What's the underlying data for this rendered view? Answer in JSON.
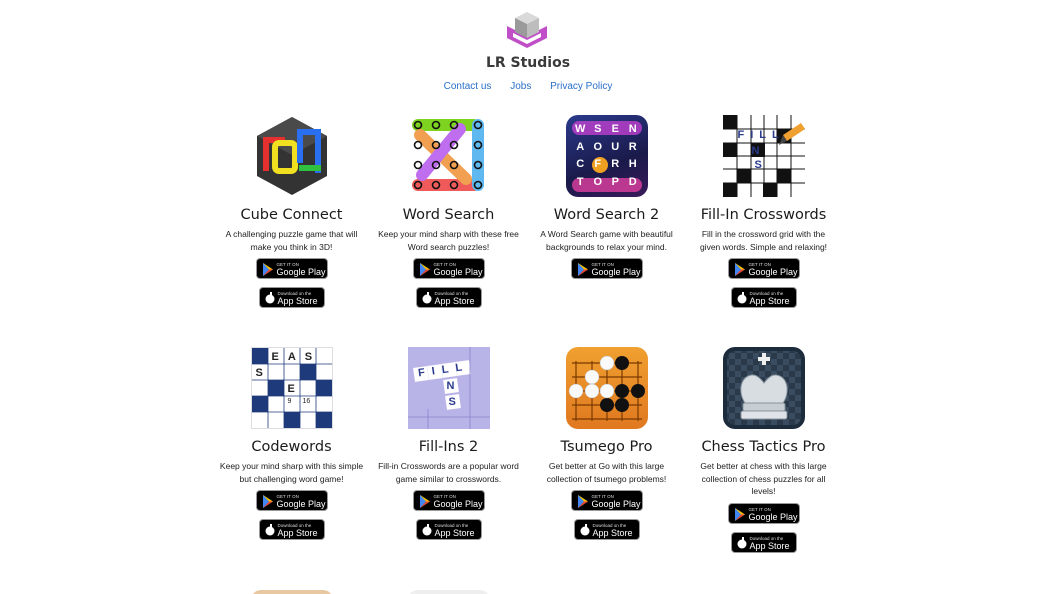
{
  "brand": {
    "name": "LR Studios",
    "logo_icon": "cube-logo-icon"
  },
  "nav": [
    {
      "label": "Contact us"
    },
    {
      "label": "Jobs"
    },
    {
      "label": "Privacy Policy"
    }
  ],
  "store_badges": {
    "google_small": "GET IT ON",
    "google_big": "Google Play",
    "apple_small": "Download on the",
    "apple_big": "App Store"
  },
  "apps": [
    {
      "title": "Cube Connect",
      "description": "A challenging puzzle game that will make you think in 3D!",
      "icon": "cube-connect-icon"
    },
    {
      "title": "Word Search",
      "description": "Keep your mind sharp with these free Word search puzzles!",
      "icon": "word-search-icon"
    },
    {
      "title": "Word Search 2",
      "description": "A Word Search game with beautiful backgrounds to relax your mind.",
      "icon": "word-search-2-icon"
    },
    {
      "title": "Fill-In Crosswords",
      "description": "Fill in the crossword grid with the given words. Simple and relaxing!",
      "icon": "fill-in-crosswords-icon"
    },
    {
      "title": "Codewords",
      "description": "Keep your mind sharp with this simple but challenging word game!",
      "icon": "codewords-icon"
    },
    {
      "title": "Fill-Ins 2",
      "description": "Fill-in Crosswords are a popular word game similar to crosswords.",
      "icon": "fill-ins-2-icon"
    },
    {
      "title": "Tsumego Pro",
      "description": "Get better at Go with this large collection of tsumego problems!",
      "icon": "tsumego-icon"
    },
    {
      "title": "Chess Tactics Pro",
      "description": "Get better at chess with this large collection of chess puzzles for all levels!",
      "icon": "chess-icon"
    }
  ],
  "icon_letters": {
    "ws2": [
      "W",
      "S",
      "E",
      "N",
      "A",
      "O",
      "U",
      "R",
      "C",
      "F",
      "R",
      "H",
      "T",
      "O",
      "P",
      "D"
    ],
    "fill": [
      "F",
      "I",
      "L",
      "L",
      "N",
      "S"
    ],
    "codewords": [
      "E",
      "A",
      "S",
      "S",
      "E",
      "9",
      "16"
    ]
  }
}
